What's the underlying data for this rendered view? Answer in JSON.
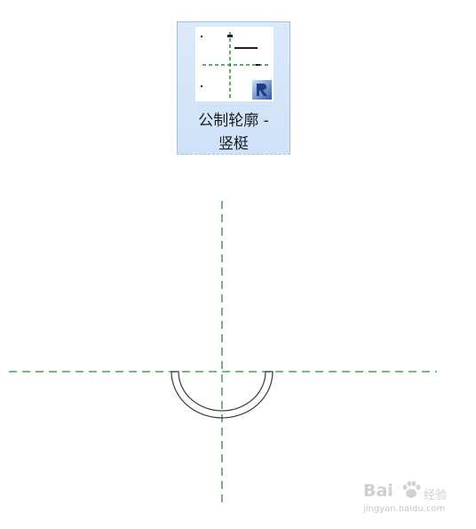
{
  "tile": {
    "label_line1": "公制轮廓 -",
    "label_line2": "竖梃"
  },
  "watermark": {
    "brand": "Bai",
    "brand_suffix": "经验",
    "url": "jingyan.baidu.com"
  },
  "colors": {
    "reference_line": "#2f8a3a",
    "profile": "#3a3a3a",
    "tile_bg": "#cfe2f8",
    "tile_border": "#9fc3ea"
  },
  "icons": {
    "tile_overlay": "revit-family-icon",
    "watermark": "baidu-paw-icon"
  }
}
